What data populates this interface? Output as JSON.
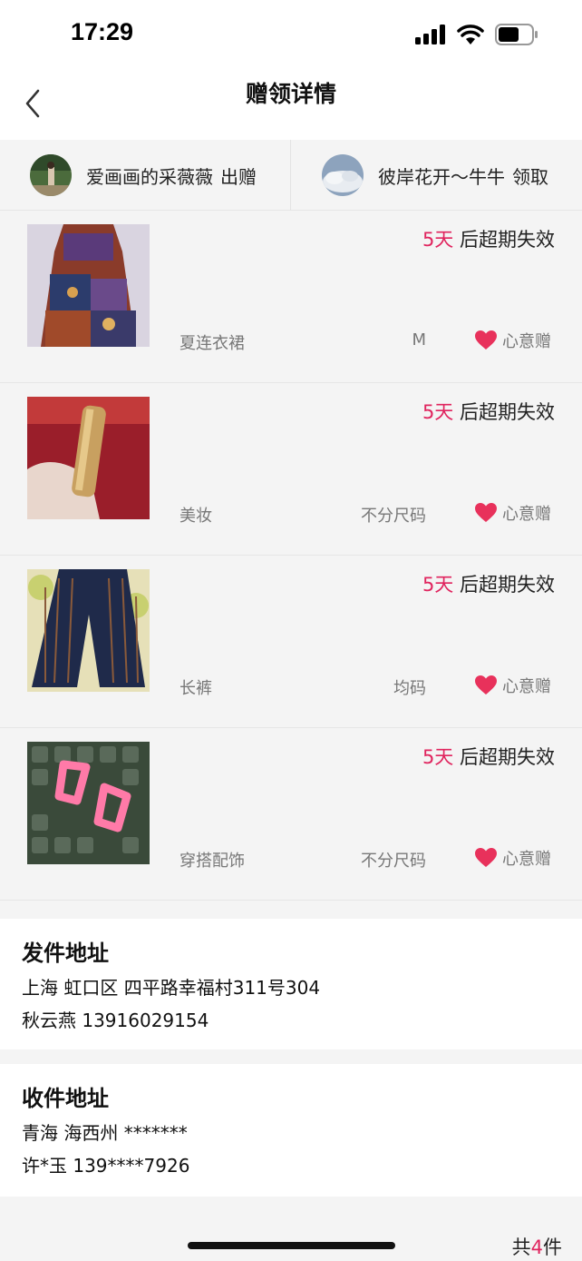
{
  "status": {
    "time": "17:29"
  },
  "nav": {
    "title": "赠领详情"
  },
  "giver": {
    "name": "爱画画的采薇薇",
    "action": "出赠"
  },
  "receiver": {
    "name": "彼岸花开～牛牛",
    "action": "领取"
  },
  "items": [
    {
      "days": "5天",
      "expiry_suffix": " 后超期失效",
      "category": "夏连衣裙",
      "size": "M",
      "gift_label": "心意赠"
    },
    {
      "days": "5天",
      "expiry_suffix": " 后超期失效",
      "category": "美妆",
      "size": "不分尺码",
      "gift_label": "心意赠"
    },
    {
      "days": "5天",
      "expiry_suffix": " 后超期失效",
      "category": "长裤",
      "size": "均码",
      "gift_label": "心意赠"
    },
    {
      "days": "5天",
      "expiry_suffix": " 后超期失效",
      "category": "穿搭配饰",
      "size": "不分尺码",
      "gift_label": "心意赠"
    }
  ],
  "send_address": {
    "title": "发件地址",
    "line1": "上海 虹口区 四平路幸福村311号304",
    "line2": "秋云燕 13916029154"
  },
  "receive_address": {
    "title": "收件地址",
    "line1": "青海 海西州 *******",
    "line2": "许*玉 139****7926"
  },
  "total": {
    "prefix": "共",
    "count": "4",
    "suffix": "件"
  },
  "colors": {
    "accent": "#e0245e",
    "heart": "#e8315b"
  },
  "icons": [
    "back-chevron-icon",
    "signal-icon",
    "wifi-icon",
    "battery-icon",
    "heart-icon"
  ]
}
